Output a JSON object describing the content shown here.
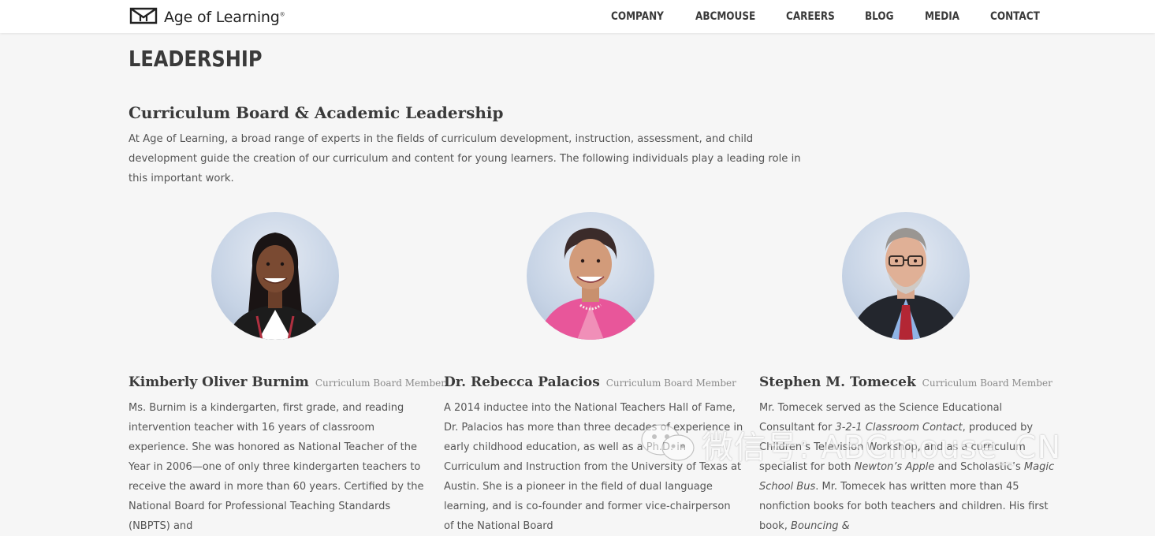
{
  "header": {
    "logo_text": "Age of Learning",
    "logo_tm": "®",
    "nav": [
      "COMPANY",
      "ABCMOUSE",
      "CAREERS",
      "BLOG",
      "MEDIA",
      "CONTACT"
    ]
  },
  "page": {
    "title": "LEADERSHIP",
    "section_title": "Curriculum Board & Academic Leadership",
    "intro": "At Age of Learning, a broad range of experts in the fields of curriculum development, instruction, assessment, and child development guide the creation of our curriculum and content for young learners. The following individuals play a leading role in this important work."
  },
  "members": [
    {
      "name": "Kimberly Oliver Burnim",
      "role": "Curriculum Board Member",
      "bio": "Ms. Burnim is a kindergarten, first grade, and reading intervention teacher with 16 years of classroom experience. She was honored as National Teacher of the Year in 2006—one of only three kindergarten teachers to receive the award in more than 60 years. Certified by the National Board for Professional Teaching Standards (NBPTS) and"
    },
    {
      "name": "Dr. Rebecca Palacios",
      "role": "Curriculum Board Member",
      "bio": "A 2014 inductee into the National Teachers Hall of Fame, Dr. Palacios has more than three decades of experience in early childhood education, as well as a Ph.D. in Curriculum and Instruction from the University of Texas at Austin. She is a pioneer in the field of dual language learning, and is co-founder and former vice-chairperson of the National Board"
    },
    {
      "name": "Stephen M. Tomecek",
      "role": "Curriculum Board Member",
      "bio_parts": [
        "Mr. Tomecek served as the Science Educational Consultant for ",
        "3-2-1 Classroom Contact",
        ", produced by Children’s Television Workshop, and as a curriculum specialist for both ",
        "Newton’s Apple",
        " and Scholastic’s ",
        "Magic School Bus",
        ". Mr. Tomecek has written more than 45 nonfiction books for both teachers and children. His first book, ",
        "Bouncing &"
      ]
    }
  ],
  "watermark": {
    "text": "微信号: ABCmouse_CN",
    "icon": "wechat-icon"
  },
  "colors": {
    "background": "#f6f6f6",
    "header": "#ffffff",
    "heading": "#3a3a3a",
    "body_text": "#555555",
    "role_text": "#8a8a8a"
  }
}
